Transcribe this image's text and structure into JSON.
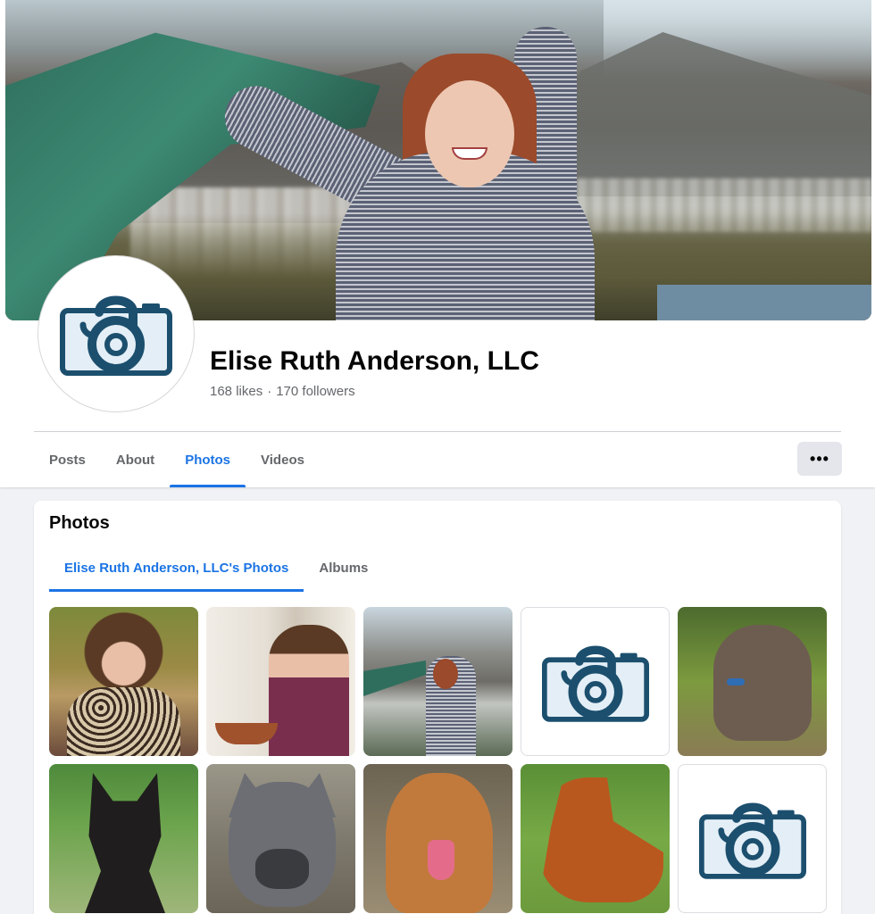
{
  "page": {
    "name": "Elise Ruth Anderson, LLC",
    "likes": "168 likes",
    "separator": "·",
    "followers": "170 followers"
  },
  "nav": {
    "tabs": [
      {
        "label": "Posts",
        "active": false
      },
      {
        "label": "About",
        "active": false
      },
      {
        "label": "Photos",
        "active": true
      },
      {
        "label": "Videos",
        "active": false
      }
    ],
    "more_label": "•••"
  },
  "photos": {
    "title": "Photos",
    "tabs": [
      {
        "label": "Elise Ruth Anderson, LLC's Photos",
        "active": true
      },
      {
        "label": "Albums",
        "active": false
      }
    ]
  },
  "colors": {
    "accent": "#1b74e4",
    "logo": "#1c4f6e",
    "logo_fill": "#e3eef6"
  }
}
